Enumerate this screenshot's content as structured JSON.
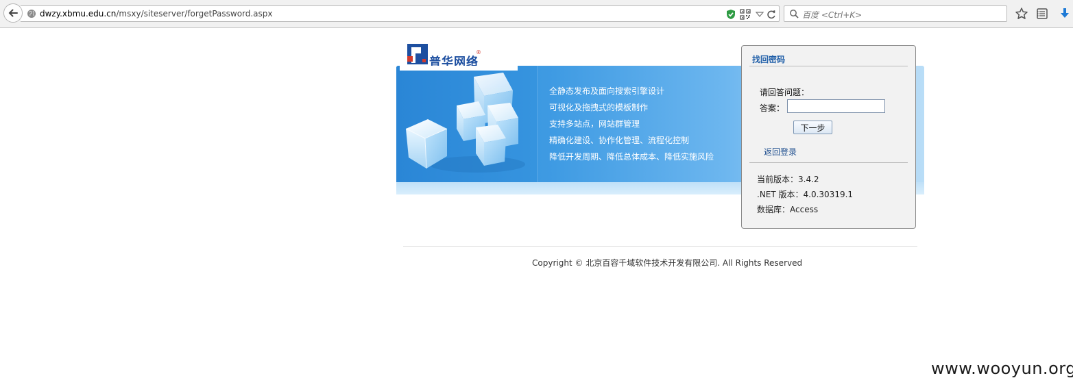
{
  "browser": {
    "url_host": "dwzy.xbmu.edu.cn",
    "url_path": "/msxy/siteserver/forgetPassword.aspx",
    "search_placeholder": "百度 <Ctrl+K>",
    "icons": [
      "back-arrow-icon",
      "globe-icon",
      "shield-icon",
      "qr-code-icon",
      "dropdown-arrow-icon",
      "reload-icon",
      "search-icon",
      "star-icon",
      "reading-list-icon",
      "download-icon"
    ]
  },
  "logo": {
    "text": "普华网络",
    "mark": "®"
  },
  "banner": {
    "features": [
      "全静态发布及面向搜索引擎设计",
      "可视化及拖拽式的模板制作",
      "支持多站点，网站群管理",
      "精确化建设、协作化管理、流程化控制",
      "降低开发周期、降低总体成本、降低实施风险"
    ]
  },
  "panel": {
    "title": "找回密码",
    "question_label": "请回答问题：",
    "answer_label": "答案：",
    "answer_value": "",
    "next_button": "下一步",
    "back_link": "返回登录",
    "version": "当前版本：3.4.2",
    "dotnet": ".NET 版本：4.0.30319.1",
    "database": "数据库：Access"
  },
  "footer": {
    "copyright": "Copyright © 北京百容千域软件技术开发有限公司. All Rights Reserved"
  },
  "watermark": "www.wooyun.org",
  "colors": {
    "banner_blue": "#3f9be3",
    "panel_title": "#1f5ea8",
    "link": "#1f4f8f",
    "download_blue": "#1e7ad6",
    "shield_green": "#2e9b43"
  }
}
